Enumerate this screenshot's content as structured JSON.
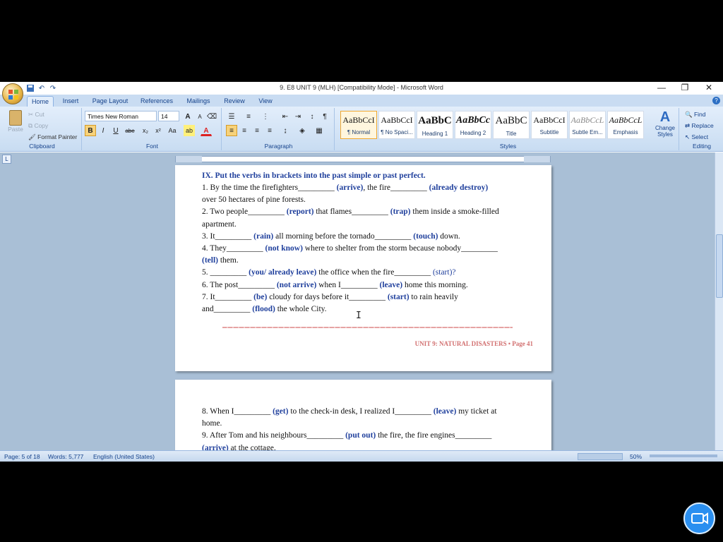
{
  "window": {
    "title": "9. E8 UNIT 9 (MLH) [Compatibility Mode] - Microsoft Word",
    "minimize": "—",
    "restore": "❐",
    "close": "✕"
  },
  "tabs": [
    "Home",
    "Insert",
    "Page Layout",
    "References",
    "Mailings",
    "Review",
    "View"
  ],
  "ribbon": {
    "clipboard": {
      "label": "Clipboard",
      "paste": "Paste",
      "cut": "Cut",
      "copy": "Copy",
      "format_painter": "Format Painter"
    },
    "font": {
      "label": "Font",
      "font_name": "Times New Roman",
      "font_size": "14",
      "grow": "A",
      "shrink": "A",
      "bold": "B",
      "italic": "I",
      "underline": "U",
      "strike": "abe",
      "subscript": "x₂",
      "superscript": "x²",
      "change_case": "Aa",
      "highlight": "ab",
      "font_color": "A"
    },
    "paragraph": {
      "label": "Paragraph",
      "show_marks": "¶"
    },
    "styles": {
      "label": "Styles",
      "items": [
        {
          "sample": "AaBbCcI",
          "name": "¶ Normal"
        },
        {
          "sample": "AaBbCcI",
          "name": "¶ No Spaci..."
        },
        {
          "sample": "AaBbC",
          "name": "Heading 1"
        },
        {
          "sample": "AaBbCc",
          "name": "Heading 2"
        },
        {
          "sample": "AaBbC",
          "name": "Title"
        },
        {
          "sample": "AaBbCcI",
          "name": "Subtitle"
        },
        {
          "sample": "AaBbCcL",
          "name": "Subtle Em..."
        },
        {
          "sample": "AaBbCcL",
          "name": "Emphasis"
        }
      ],
      "change_styles": "Change Styles"
    },
    "editing": {
      "label": "Editing",
      "find": "Find",
      "replace": "Replace",
      "select": "Select"
    }
  },
  "document": {
    "page1": {
      "heading": "IX. Put the verbs in brackets into the past simple or past perfect.",
      "lines": [
        {
          "text": "1. By the time the firefighters_________ ",
          "verb": "(arrive)",
          "rest": ", the fire_________ ",
          "verb2": "(already destroy)"
        },
        {
          "text": "over 50 hectares of pine forests."
        },
        {
          "text": "2. Two people_________ ",
          "verb": "(report)",
          "rest": " that flames_________ ",
          "verb2": "(trap)",
          "rest2": " them inside a smoke-filled"
        },
        {
          "text": "apartment."
        },
        {
          "text": "3. It_________ ",
          "verb": "(rain)",
          "rest": " all morning before the tornado_________ ",
          "verb2": "(touch)",
          "rest2": " down."
        },
        {
          "text": "4. They_________ ",
          "verb": "(not know)",
          "rest": " where to shelter from the storm because nobody_________"
        },
        {
          "text": "",
          "verb": "(tell)",
          "rest": " them."
        },
        {
          "text": "5. _________ ",
          "verb": "(you/ already leave)",
          "rest": " the office when the fire_________ ",
          "rest_plain": "(start)?"
        },
        {
          "text": "6. The post_________ ",
          "verb": "(not arrive)",
          "rest": " when I_________ ",
          "verb2": "(leave)",
          "rest2": " home this morning."
        },
        {
          "text": "7. It_________ ",
          "verb": "(be)",
          "rest": " cloudy for days before it_________ ",
          "verb2": "(start)",
          "rest2": " to rain heavily"
        },
        {
          "text": "and_________ ",
          "verb": "(flood)",
          "rest": " the whole City."
        }
      ],
      "footer": "UNIT 9: NATURAL DISASTERS • Page 41"
    },
    "page2": {
      "lines": [
        {
          "text": "8. When I_________ ",
          "verb": "(get)",
          "rest": " to the check-in desk, I realized I_________ ",
          "verb2": "(leave)",
          "rest2": " my ticket at"
        },
        {
          "text": "home."
        },
        {
          "text": "9. After Tom and his neighbours_________ ",
          "verb": "(put out)",
          "rest": " the fire, the fire engines_________"
        },
        {
          "text": "",
          "verb": "(arrive)",
          "rest": " at the cottage."
        }
      ]
    }
  },
  "status": {
    "page": "Page: 5 of 18",
    "words": "Words: 5,777",
    "language": "English (United States)",
    "zoom": "50%"
  },
  "colors": {
    "accent": "#1f3f9c",
    "ribbon": "#c8dcf2",
    "footer": "#d27070",
    "video_button": "#2a8ff0"
  },
  "icons": [
    "office-button-icon",
    "save-icon",
    "undo-icon",
    "redo-icon",
    "help-icon",
    "video-call-icon",
    "text-cursor-icon"
  ]
}
